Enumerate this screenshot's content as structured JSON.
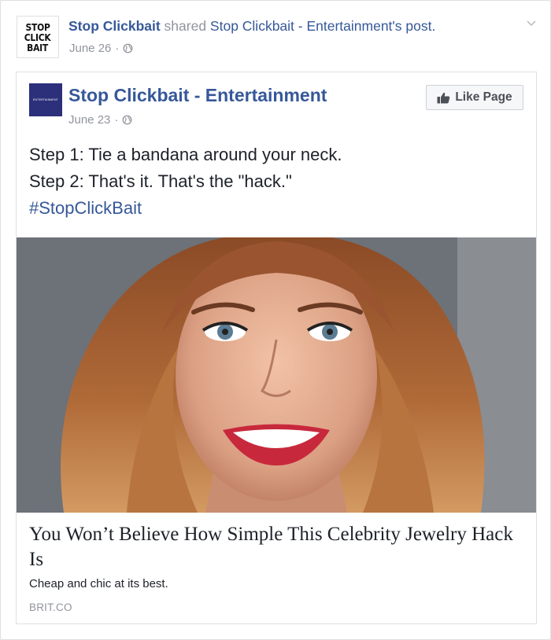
{
  "share_header": {
    "avatar_lines": [
      "STOP",
      "CLICK",
      "BAIT"
    ],
    "actor": "Stop Clickbait",
    "verb": " shared ",
    "target": "Stop Clickbait - Entertainment",
    "suffix": "'s post.",
    "date": "June 26",
    "separator": "·",
    "privacy_icon": "globe-icon",
    "menu_icon": "chevron-down-icon"
  },
  "original_post": {
    "avatar_text": "ENTERTAINMENT",
    "page_name": "Stop Clickbait - Entertainment",
    "like_button": "Like Page",
    "like_icon": "thumbs-up-icon",
    "date": "June 23",
    "separator": "·",
    "lines": [
      "Step 1: Tie a bandana around your neck.",
      "Step 2: That's it. That's the \"hack.\""
    ],
    "hashtag": "#StopClickBait"
  },
  "link_preview": {
    "title": "You Won’t Believe How Simple This Celebrity Jewelry Hack Is",
    "description": "Cheap and chic at its best.",
    "domain": "BRIT.CO"
  },
  "colors": {
    "link_blue": "#365899",
    "meta_gray": "#90949c",
    "text": "#1d2129",
    "border": "#dddfe2"
  }
}
